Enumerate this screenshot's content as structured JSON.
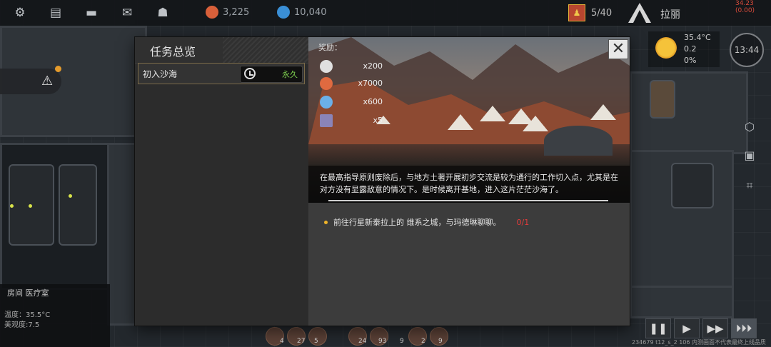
{
  "hud": {
    "resources": [
      {
        "icon": "flesh-icon",
        "color": "#d9603a",
        "value": "3,225"
      },
      {
        "icon": "crystal-icon",
        "color": "#3a8fd6",
        "value": "10,040"
      }
    ],
    "crew_count": "5/40",
    "username": "拉丽",
    "red_note": "34.23 (0.00)"
  },
  "weather": {
    "temperature": "35.4°C",
    "wind": "0.2",
    "humidity": "0%",
    "time": "13:44"
  },
  "room_info": {
    "title": "房间 医疗室",
    "temperature": "温度：35.5°C",
    "beauty": "美观度:7.5"
  },
  "build_info": "234679 t12_s_2 106  内测画面不代表最终上线品质",
  "dialog": {
    "title": "任务总览",
    "tasks": [
      {
        "name": "初入沙海",
        "duration": "永久"
      }
    ],
    "rewards_label": "奖励：",
    "rewards": [
      {
        "icon": "settings-part-icon",
        "color": "#e0e0e0",
        "qty": "x200"
      },
      {
        "icon": "flesh-icon",
        "color": "#e06a40",
        "qty": "x7000"
      },
      {
        "icon": "crystal-icon",
        "color": "#6bb0e8",
        "qty": "x600"
      },
      {
        "icon": "ticket-icon",
        "color": "#8a84b8",
        "qty": "x5"
      }
    ],
    "description": "在最高指导原则废除后，与地方土著开展初步交流是较为通行的工作切入点，尤其是在对方没有显露敌意的情况下。是时候离开基地，进入这片茫茫沙海了。",
    "objective": {
      "text": "前往行星新泰拉上的 维系之城，与玛德琳聊聊。",
      "progress": "0/1"
    },
    "close_label": "✕"
  },
  "bottom_numbers": [
    "4",
    "27",
    "5",
    "24",
    "93",
    "9",
    "2",
    "9"
  ]
}
